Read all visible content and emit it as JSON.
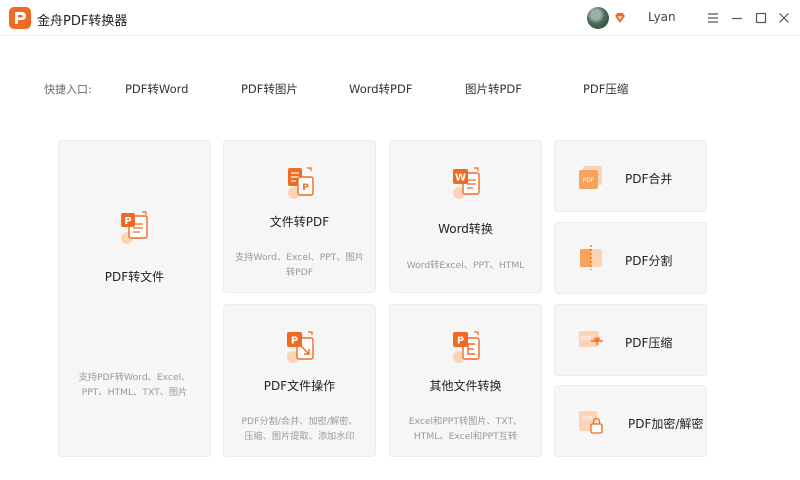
{
  "titlebar": {
    "app_title": "金舟PDF转换器",
    "user_name": "Lyan"
  },
  "quick_entry": {
    "label": "快捷入口:",
    "links": [
      "PDF转Word",
      "PDF转图片",
      "Word转PDF",
      "图片转PDF",
      "PDF压缩"
    ]
  },
  "cards": {
    "pdf_to_file": {
      "title": "PDF转文件",
      "desc": "支持PDF转Word、Excel、\nPPT、HTML、TXT、图片"
    },
    "file_to_pdf": {
      "title": "文件转PDF",
      "desc": "支持Word、Excel、PPT、图片\n转PDF"
    },
    "word_convert": {
      "title": "Word转换",
      "desc": "Word转Excel、PPT、HTML"
    },
    "pdf_file_ops": {
      "title": "PDF文件操作",
      "desc": "PDF分割/合并、加密/解密、\n压缩、图片提取、添加水印"
    },
    "other_convert": {
      "title": "其他文件转换",
      "desc": "Excel和PPT转图片、TXT、\nHTML、Excel和PPT互转"
    },
    "pdf_merge": {
      "title": "PDF合并"
    },
    "pdf_split": {
      "title": "PDF分割"
    },
    "pdf_compress": {
      "title": "PDF压缩"
    },
    "pdf_encrypt": {
      "title": "PDF加密/解密"
    }
  },
  "colors": {
    "accent": "#f06a24",
    "accent_light": "#fbd3b5",
    "card_bg": "#f6f6f6"
  }
}
